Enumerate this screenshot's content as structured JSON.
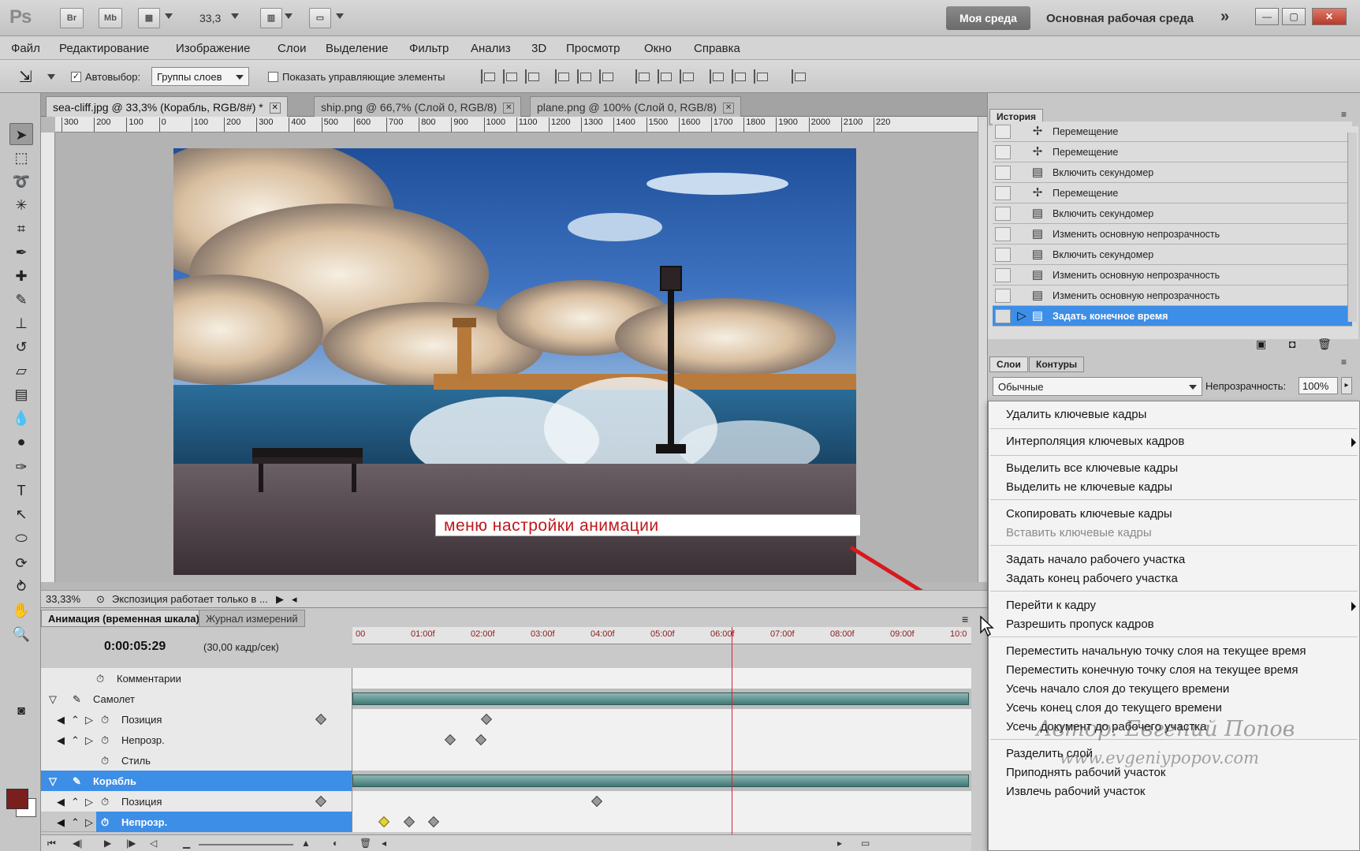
{
  "titlebar": {
    "logo": "Ps",
    "btn_br": "Br",
    "btn_mb": "Mb",
    "zoom": "33,3",
    "workspace_active": "Моя среда",
    "workspace_main": "Основная рабочая среда",
    "more": "»"
  },
  "menubar": [
    "Файл",
    "Редактирование",
    "Изображение",
    "Слои",
    "Выделение",
    "Фильтр",
    "Анализ",
    "3D",
    "Просмотр",
    "Окно",
    "Справка"
  ],
  "options": {
    "autoselect_label": "Автовыбор:",
    "autoselect_value": "Группы слоев",
    "show_controls_label": "Показать управляющие элементы"
  },
  "doc_tabs": [
    {
      "label": "sea-cliff.jpg @ 33,3% (Корабль, RGB/8#) *",
      "active": true
    },
    {
      "label": "ship.png @ 66,7% (Слой 0, RGB/8)",
      "active": false
    },
    {
      "label": "plane.png @ 100% (Слой 0, RGB/8)",
      "active": false
    }
  ],
  "ruler_top": [
    "300",
    "200",
    "100",
    "0",
    "100",
    "200",
    "300",
    "400",
    "500",
    "600",
    "700",
    "800",
    "900",
    "1000",
    "1100",
    "1200",
    "1300",
    "1400",
    "1500",
    "1600",
    "1700",
    "1800",
    "1900",
    "2000",
    "2100",
    "220"
  ],
  "status": {
    "zoom": "33,33%",
    "message": "Экспозиция работает только в ..."
  },
  "callout": {
    "text": "меню настройки анимации"
  },
  "timeline": {
    "tabs": [
      "Анимация (временная шкала)",
      "Журнал измерений"
    ],
    "current_time": "0:00:05:29",
    "fps": "(30,00 кадр/сек)",
    "ticks": [
      "00",
      "01:00f",
      "02:00f",
      "03:00f",
      "04:00f",
      "05:00f",
      "06:00f",
      "07:00f",
      "08:00f",
      "09:00f",
      "10:0"
    ],
    "rows": [
      {
        "label": "Комментарии",
        "kind": "comment"
      },
      {
        "label": "Самолет",
        "kind": "layer"
      },
      {
        "label": "Позиция",
        "kind": "prop"
      },
      {
        "label": "Непрозр.",
        "kind": "prop"
      },
      {
        "label": "Стиль",
        "kind": "prop"
      },
      {
        "label": "Корабль",
        "kind": "layer"
      },
      {
        "label": "Позиция",
        "kind": "prop"
      },
      {
        "label": "Непрозр.",
        "kind": "prop"
      }
    ]
  },
  "history": {
    "tab": "История",
    "items": [
      {
        "label": "Перемещение",
        "icon": "move-icon"
      },
      {
        "label": "Перемещение",
        "icon": "move-icon"
      },
      {
        "label": "Включить секундомер",
        "icon": "history-state-icon"
      },
      {
        "label": "Перемещение",
        "icon": "move-icon"
      },
      {
        "label": "Включить секундомер",
        "icon": "history-state-icon"
      },
      {
        "label": "Изменить основную непрозрачность",
        "icon": "history-state-icon"
      },
      {
        "label": "Включить секундомер",
        "icon": "history-state-icon"
      },
      {
        "label": "Изменить основную непрозрачность",
        "icon": "history-state-icon"
      },
      {
        "label": "Изменить основную непрозрачность",
        "icon": "history-state-icon"
      },
      {
        "label": "Задать конечное время",
        "icon": "history-state-icon"
      }
    ]
  },
  "layers": {
    "tabs": [
      "Слои",
      "Контуры"
    ],
    "blend_mode": "Обычные",
    "opacity_label": "Непрозрачность:",
    "opacity_value": "100%"
  },
  "context_menu": {
    "items": [
      {
        "label": "Удалить ключевые кадры",
        "disabled": false
      },
      {
        "label": "Интерполяция ключевых кадров",
        "disabled": false
      },
      {
        "label": "Выделить все ключевые кадры",
        "disabled": false
      },
      {
        "label": "Выделить не ключевые кадры",
        "disabled": false
      },
      {
        "label": "Скопировать ключевые кадры",
        "disabled": false
      },
      {
        "label": "Вставить ключевые кадры",
        "disabled": true
      },
      {
        "label": "Задать начало рабочего участка",
        "disabled": false
      },
      {
        "label": "Задать конец рабочего участка",
        "disabled": false
      },
      {
        "label": "Перейти к кадру",
        "disabled": false
      },
      {
        "label": "Разрешить пропуск кадров",
        "disabled": false
      },
      {
        "label": "Переместить начальную точку слоя на текущее время",
        "disabled": false
      },
      {
        "label": "Переместить конечную точку слоя на текущее время",
        "disabled": false
      },
      {
        "label": "Усечь начало слоя до текущего времени",
        "disabled": false
      },
      {
        "label": "Усечь конец слоя до текущего времени",
        "disabled": false
      },
      {
        "label": "Усечь документ до рабочего участка",
        "disabled": false
      },
      {
        "label": "Разделить слой",
        "disabled": false
      },
      {
        "label": "Приподнять рабочий участок",
        "disabled": false
      },
      {
        "label": "Извлечь рабочий участок",
        "disabled": false
      }
    ]
  },
  "watermark": {
    "author": "Автор: Евгений Попов",
    "site": "www.evgeniypopov.com"
  },
  "colors": {
    "selection": "#3d8ee6",
    "foreground": "#7a1e1e",
    "callout_text": "#c0181c",
    "arrow": "#d8191c",
    "layer_bar": "#4f8986"
  }
}
